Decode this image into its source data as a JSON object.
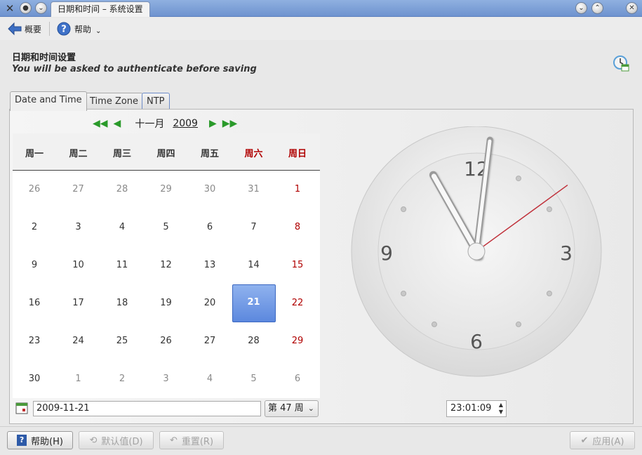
{
  "window": {
    "title": "日期和时间 – 系统设置"
  },
  "toolbar": {
    "overview_label": "概要",
    "help_label": "帮助"
  },
  "header": {
    "title": "日期和时间设置",
    "subtitle": "You will be asked to authenticate before saving"
  },
  "tabs": [
    {
      "label": "Date and Time",
      "active": true
    },
    {
      "label": "Time Zone",
      "active": false
    },
    {
      "label": "NTP",
      "active": false
    }
  ],
  "calendar": {
    "month": "十一月",
    "year": "2009",
    "day_names": [
      "周一",
      "周二",
      "周三",
      "周四",
      "周五",
      "周六",
      "周日"
    ],
    "weeks": [
      [
        "26",
        "27",
        "28",
        "29",
        "30",
        "31",
        "1"
      ],
      [
        "2",
        "3",
        "4",
        "5",
        "6",
        "7",
        "8"
      ],
      [
        "9",
        "10",
        "11",
        "12",
        "13",
        "14",
        "15"
      ],
      [
        "16",
        "17",
        "18",
        "19",
        "20",
        "21",
        "22"
      ],
      [
        "23",
        "24",
        "25",
        "26",
        "27",
        "28",
        "29"
      ],
      [
        "30",
        "1",
        "2",
        "3",
        "4",
        "5",
        "6"
      ]
    ],
    "selected": "21",
    "date_value": "2009-11-21",
    "week_label": "第 47 周"
  },
  "clock": {
    "time": "23:01:09",
    "numerals": [
      "12",
      "3",
      "6",
      "9"
    ],
    "hour": 23,
    "minute": 1,
    "second": 9
  },
  "buttons": {
    "help": "帮助(H)",
    "defaults": "默认值(D)",
    "reset": "重置(R)",
    "apply": "应用(A)"
  },
  "colors": {
    "accent": "#5c88de",
    "weekend": "#b00000",
    "nav_arrows": "#2a9a2a",
    "second_hand": "#c0303a"
  }
}
